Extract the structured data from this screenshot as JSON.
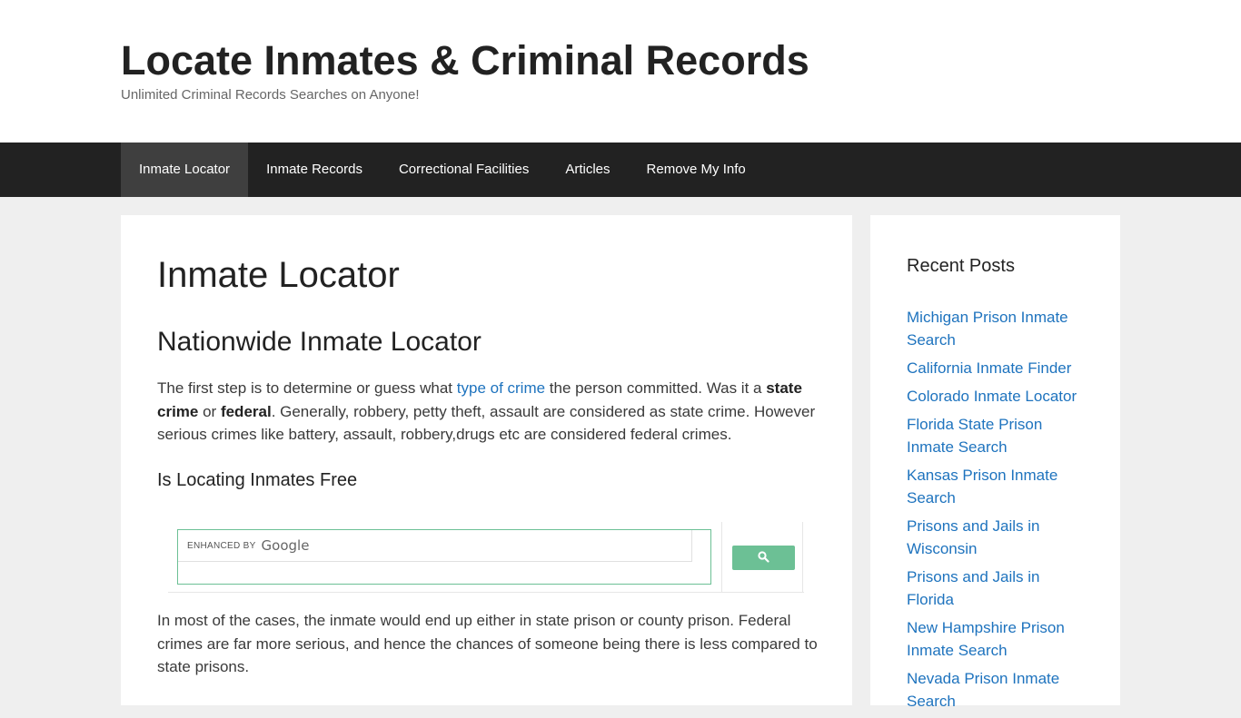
{
  "header": {
    "site_title": "Locate Inmates & Criminal Records",
    "tagline": "Unlimited Criminal Records Searches on Anyone!"
  },
  "nav": {
    "items": [
      {
        "label": "Inmate Locator",
        "active": true
      },
      {
        "label": "Inmate Records",
        "active": false
      },
      {
        "label": "Correctional Facilities",
        "active": false
      },
      {
        "label": "Articles",
        "active": false
      },
      {
        "label": "Remove My Info",
        "active": false
      }
    ]
  },
  "main": {
    "page_title": "Inmate Locator",
    "section_heading": "Nationwide Inmate Locator",
    "para1": {
      "t1": "The first step is to determine or guess what ",
      "link": "type of crime",
      "t2": " the person committed. Was it a ",
      "b1": "state crime",
      "t3": " or ",
      "b2": "federal",
      "t4": ". Generally, robbery, petty theft, assault are considered as state crime. However serious crimes like battery, assault, robbery,drugs etc are considered federal crimes."
    },
    "sub_heading": "Is Locating Inmates Free",
    "search": {
      "enhanced_by": "ENHANCED BY",
      "brand": "Google",
      "value": "",
      "button_icon": "search-icon"
    },
    "para2": "In most of the cases, the inmate would end up either in state prison or county prison. Federal crimes are far more serious, and hence the chances of someone being there is less compared to state prisons."
  },
  "sidebar": {
    "widget_title": "Recent Posts",
    "posts": [
      "Michigan Prison Inmate Search",
      "California Inmate Finder",
      "Colorado Inmate Locator",
      "Florida State Prison Inmate Search",
      "Kansas Prison Inmate Search",
      "Prisons and Jails in Wisconsin",
      "Prisons and Jails in Florida",
      "New Hampshire Prison Inmate Search",
      "Nevada Prison Inmate Search"
    ]
  },
  "colors": {
    "nav_bg": "#222222",
    "nav_active": "#3f3f3f",
    "link": "#1e73be",
    "search_accent": "#6cc095",
    "page_bg": "#efefef"
  }
}
